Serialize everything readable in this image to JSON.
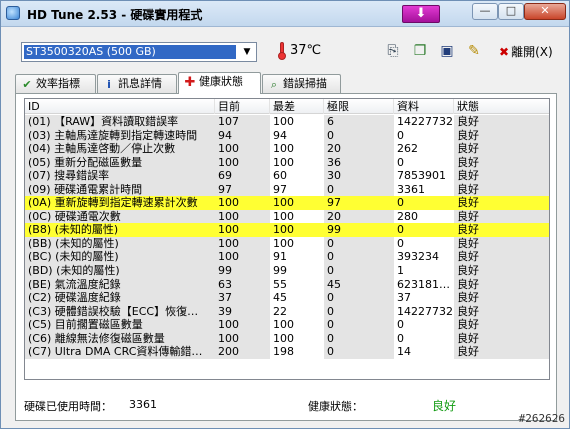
{
  "window": {
    "title": "HD Tune 2.53 - 硬碟實用程式",
    "minimize_glyph": "—",
    "maximize_glyph": "□",
    "close_glyph": "✕",
    "download_glyph": "⬇"
  },
  "toolbar": {
    "drive": "ST3500320AS (500 GB)",
    "temperature": "37℃",
    "exit_label": "離開(X)",
    "exit_glyph": "✖",
    "icons": [
      "copy-icon",
      "copy-screenshot-icon",
      "save-icon",
      "options-icon"
    ]
  },
  "tabs": [
    {
      "label": "效率指標",
      "icon": "benchmark-icon"
    },
    {
      "label": "訊息詳情",
      "icon": "info-icon"
    },
    {
      "label": "健康狀態",
      "icon": "health-cross-icon"
    },
    {
      "label": "錯誤掃描",
      "icon": "search-icon"
    }
  ],
  "table": {
    "headers": [
      "ID",
      "目前",
      "最差",
      "極限",
      "資料",
      "狀態"
    ],
    "rows": [
      {
        "id": "(01) 【RAW】資料讀取錯誤率",
        "cur": "107",
        "worst": "100",
        "thr": "6",
        "data": "14227732",
        "status": "良好",
        "hl": false
      },
      {
        "id": "(03) 主軸馬達旋轉到指定轉速時間",
        "cur": "94",
        "worst": "94",
        "thr": "0",
        "data": "0",
        "status": "良好",
        "hl": false
      },
      {
        "id": "(04) 主軸馬達啓動／停止次數",
        "cur": "100",
        "worst": "100",
        "thr": "20",
        "data": "262",
        "status": "良好",
        "hl": false
      },
      {
        "id": "(05) 重新分配磁區數量",
        "cur": "100",
        "worst": "100",
        "thr": "36",
        "data": "0",
        "status": "良好",
        "hl": false
      },
      {
        "id": "(07) 搜尋錯誤率",
        "cur": "69",
        "worst": "60",
        "thr": "30",
        "data": "7853901",
        "status": "良好",
        "hl": false
      },
      {
        "id": "(09) 硬碟通電累計時間",
        "cur": "97",
        "worst": "97",
        "thr": "0",
        "data": "3361",
        "status": "良好",
        "hl": false
      },
      {
        "id": "(0A) 重新旋轉到指定轉速累計次數",
        "cur": "100",
        "worst": "100",
        "thr": "97",
        "data": "0",
        "status": "良好",
        "hl": true
      },
      {
        "id": "(0C) 硬碟通電次數",
        "cur": "100",
        "worst": "100",
        "thr": "20",
        "data": "280",
        "status": "良好",
        "hl": false
      },
      {
        "id": "(B8) (未知的屬性)",
        "cur": "100",
        "worst": "100",
        "thr": "99",
        "data": "0",
        "status": "良好",
        "hl": true
      },
      {
        "id": "(BB) (未知的屬性)",
        "cur": "100",
        "worst": "100",
        "thr": "0",
        "data": "0",
        "status": "良好",
        "hl": false
      },
      {
        "id": "(BC) (未知的屬性)",
        "cur": "100",
        "worst": "91",
        "thr": "0",
        "data": "393234",
        "status": "良好",
        "hl": false
      },
      {
        "id": "(BD) (未知的屬性)",
        "cur": "99",
        "worst": "99",
        "thr": "0",
        "data": "1",
        "status": "良好",
        "hl": false
      },
      {
        "id": "(BE) 氣流溫度紀錄",
        "cur": "63",
        "worst": "55",
        "thr": "45",
        "data": "623181…",
        "status": "良好",
        "hl": false
      },
      {
        "id": "(C2) 硬碟溫度紀錄",
        "cur": "37",
        "worst": "45",
        "thr": "0",
        "data": "37",
        "status": "良好",
        "hl": false
      },
      {
        "id": "(C3) 硬體錯誤校驗【ECC】恢復…",
        "cur": "39",
        "worst": "22",
        "thr": "0",
        "data": "14227732",
        "status": "良好",
        "hl": false
      },
      {
        "id": "(C5) 目前擱置磁區數量",
        "cur": "100",
        "worst": "100",
        "thr": "0",
        "data": "0",
        "status": "良好",
        "hl": false
      },
      {
        "id": "(C6) 離線無法修復磁區數量",
        "cur": "100",
        "worst": "100",
        "thr": "0",
        "data": "0",
        "status": "良好",
        "hl": false
      },
      {
        "id": "(C7) Ultra DMA CRC資料傳輸錯…",
        "cur": "200",
        "worst": "198",
        "thr": "0",
        "data": "14",
        "status": "良好",
        "hl": false
      }
    ]
  },
  "footer": {
    "used_label": "硬碟已使用時間：",
    "used_value": "3361",
    "health_label": "健康狀態：",
    "health_value": "良好"
  },
  "watermark": "#262626"
}
